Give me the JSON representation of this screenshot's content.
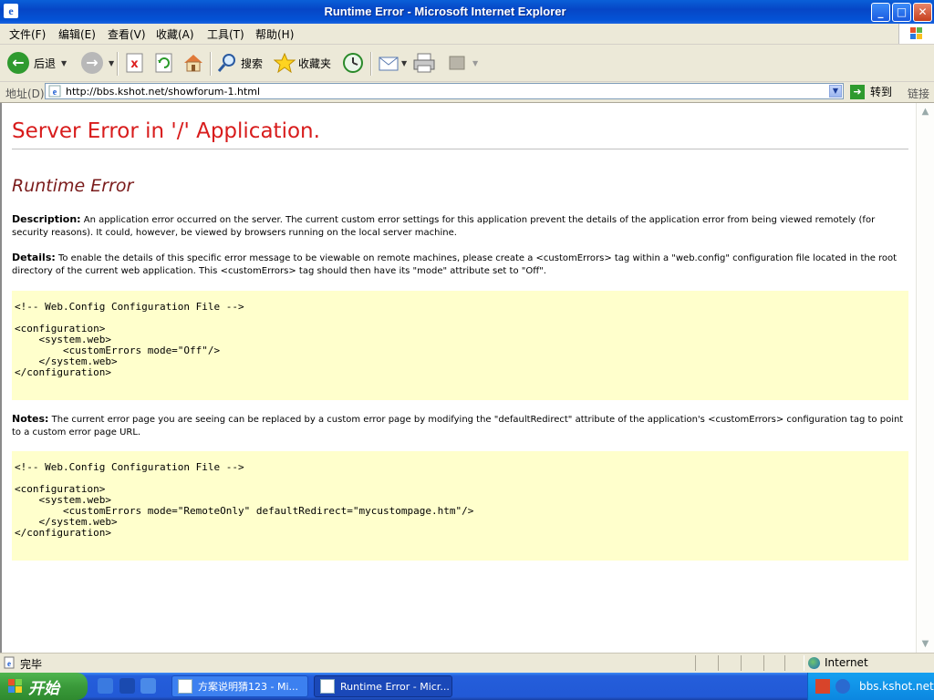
{
  "window": {
    "title": "Runtime Error - Microsoft Internet Explorer",
    "buttons": {
      "minimize": "_",
      "maximize": "□",
      "close": "✕"
    }
  },
  "menu": {
    "items": [
      "文件(F)",
      "编辑(E)",
      "查看(V)",
      "收藏(A)",
      "工具(T)",
      "帮助(H)"
    ]
  },
  "toolbar": {
    "back_label": "后退",
    "search_label": "搜索",
    "favorites_label": "收藏夹"
  },
  "address": {
    "label": "地址(D)",
    "url": "http://bbs.kshot.net/showforum-1.html",
    "go_label": "转到",
    "links_label": "链接"
  },
  "page": {
    "heading": "Server Error in '/' Application.",
    "subheading": "Runtime Error",
    "description_label": "Description:",
    "description_text": " An application error occurred on the server. The current custom error settings for this application prevent the details of the application error from being viewed remotely (for security reasons). It could, however, be viewed by browsers running on the local server machine.",
    "details_label": "Details:",
    "details_text": " To enable the details of this specific error message to be viewable on remote machines, please create a <customErrors> tag within a \"web.config\" configuration file located in the root directory of the current web application. This <customErrors> tag should then have its \"mode\" attribute set to \"Off\".",
    "code1": "\n<!-- Web.Config Configuration File -->\n\n<configuration>\n    <system.web>\n        <customErrors mode=\"Off\"/>\n    </system.web>\n</configuration>\n",
    "notes_label": "Notes:",
    "notes_text": " The current error page you are seeing can be replaced by a custom error page by modifying the \"defaultRedirect\" attribute of the application's <customErrors> configuration tag to point to a custom error page URL.",
    "code2": "\n<!-- Web.Config Configuration File -->\n\n<configuration>\n    <system.web>\n        <customErrors mode=\"RemoteOnly\" defaultRedirect=\"mycustompage.htm\"/>\n    </system.web>\n</configuration>\n"
  },
  "status": {
    "text": "完毕",
    "zone": "Internet"
  },
  "taskbar": {
    "start_label": "开始",
    "tasks": [
      "方案说明猜123 - Mi...",
      "Runtime Error - Micr..."
    ],
    "tray_text": "bbs.kshot.net"
  },
  "colors": {
    "heading": "#d81c1c",
    "subheading": "#7a1b1b",
    "code_bg": "#ffffcc",
    "titlebar": "#0453d6",
    "taskbar": "#245edb",
    "start": "#3a9a3a"
  }
}
